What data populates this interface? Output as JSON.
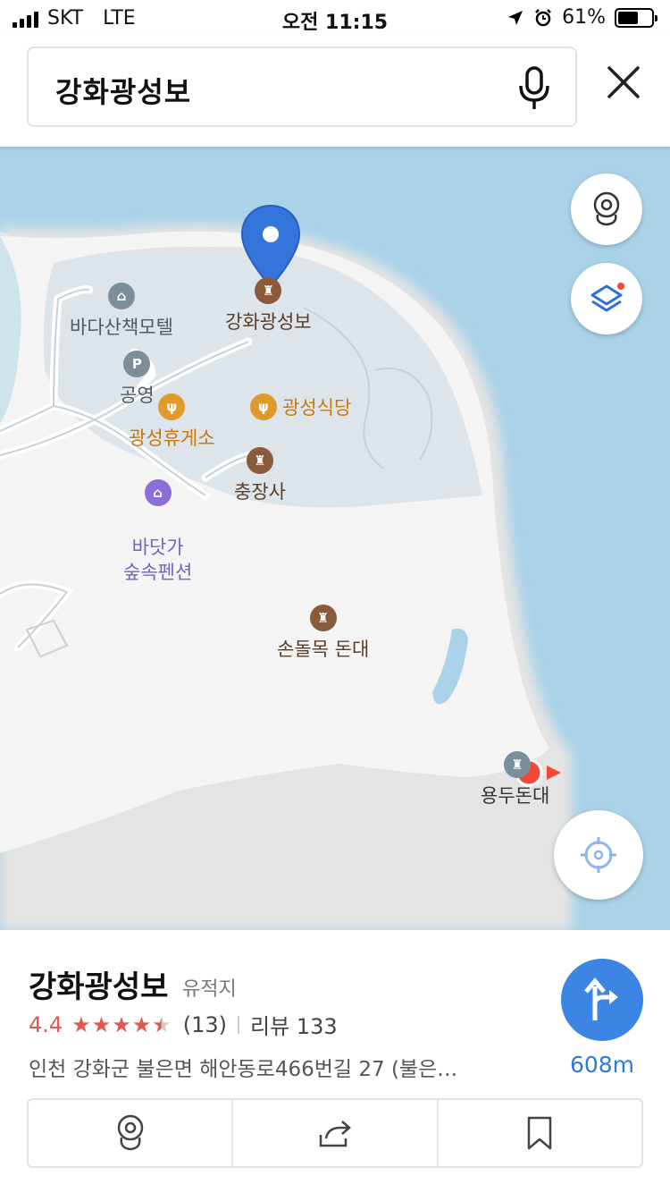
{
  "status_bar": {
    "carrier": "SKT",
    "network": "LTE",
    "time": "오전 11:15",
    "battery": "61%",
    "battery_level": 0.61
  },
  "search": {
    "query": "강화광성보"
  },
  "map": {
    "pois": [
      {
        "id": "motel",
        "label": "바다산책모텔",
        "icon": "bed-icon",
        "color": "#7b8e9a"
      },
      {
        "id": "selected",
        "label": "강화광성보",
        "icon": "fortress-icon",
        "color": "#8a5a3c"
      },
      {
        "id": "parking",
        "label": "공영",
        "icon": "parking-icon",
        "color": "#7b8e9a"
      },
      {
        "id": "restaurant",
        "label": "광성식당",
        "icon": "restaurant-icon",
        "color": "#e09a2c"
      },
      {
        "id": "reststop",
        "label": "광성휴게소",
        "icon": "restaurant-icon",
        "color": "#e09a2c"
      },
      {
        "id": "shrine",
        "label": "충장사",
        "icon": "fortress-icon",
        "color": "#8a5a3c"
      },
      {
        "id": "pension",
        "label": "바닷가\n숲속펜션",
        "icon": "bed-icon",
        "color": "#8c6fd6"
      },
      {
        "id": "sondolmok",
        "label": "손돌목 돈대",
        "icon": "fortress-icon",
        "color": "#8a5a3c"
      },
      {
        "id": "yongdu",
        "label": "용두돈대",
        "icon": "fortress-icon",
        "color": "#7b8e9a"
      }
    ]
  },
  "place": {
    "name": "강화광성보",
    "category": "유적지",
    "rating": "4.4",
    "stars_value": 4.4,
    "review_count": "(13)",
    "reviews": "리뷰 133",
    "address": "인천 강화군 불은면 해안동로466번길 27 (불은…",
    "distance": "608m"
  },
  "colors": {
    "water": "#abd3e7",
    "land": "#f4f4f4",
    "accent": "#3d85e4",
    "rating": "#e0584f"
  }
}
